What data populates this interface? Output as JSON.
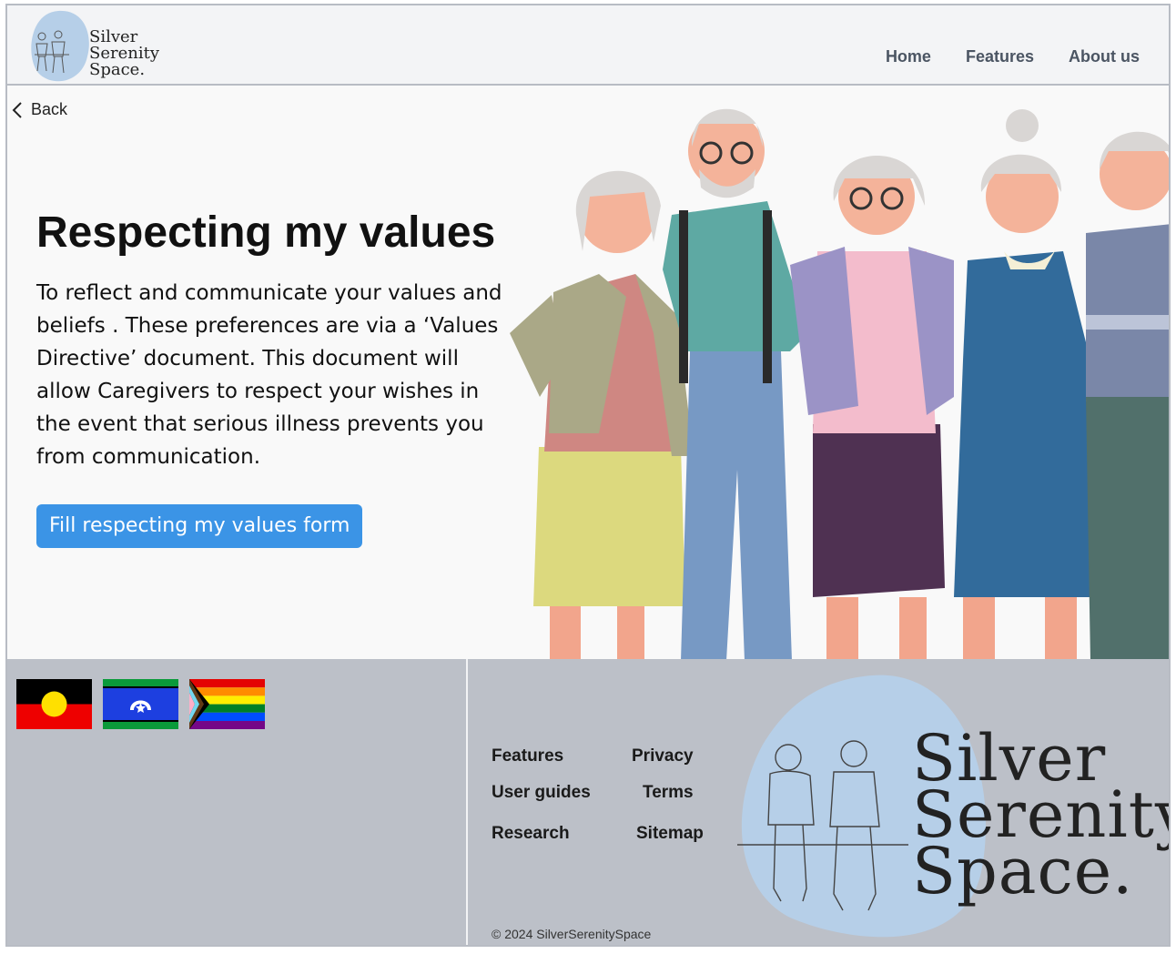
{
  "brand": {
    "line1": "Silver",
    "line2": "Serenity",
    "line3": "Space."
  },
  "nav": {
    "home": "Home",
    "features": "Features",
    "about": "About us"
  },
  "back_label": "Back",
  "hero": {
    "title": "Respecting my values",
    "description": "To reflect and communicate your values and beliefs . These preferences are via a ‘Values Directive’ document. This document will allow Caregivers to respect your wishes in the event that serious illness prevents you from communication.",
    "cta": "Fill respecting my values form"
  },
  "footer": {
    "links": {
      "features": "Features",
      "privacy": "Privacy",
      "user_guides": "User guides",
      "terms": "Terms",
      "research": "Research",
      "sitemap": "Sitemap"
    },
    "copyright": "© 2024 SilverSerenitySpace",
    "flags": [
      "aboriginal-flag",
      "torres-strait-islander-flag",
      "progress-pride-flag"
    ]
  },
  "colors": {
    "accent": "#3b94e6",
    "footer_bg": "#bcc0c8",
    "logo_blob": "#b6cfe8"
  }
}
